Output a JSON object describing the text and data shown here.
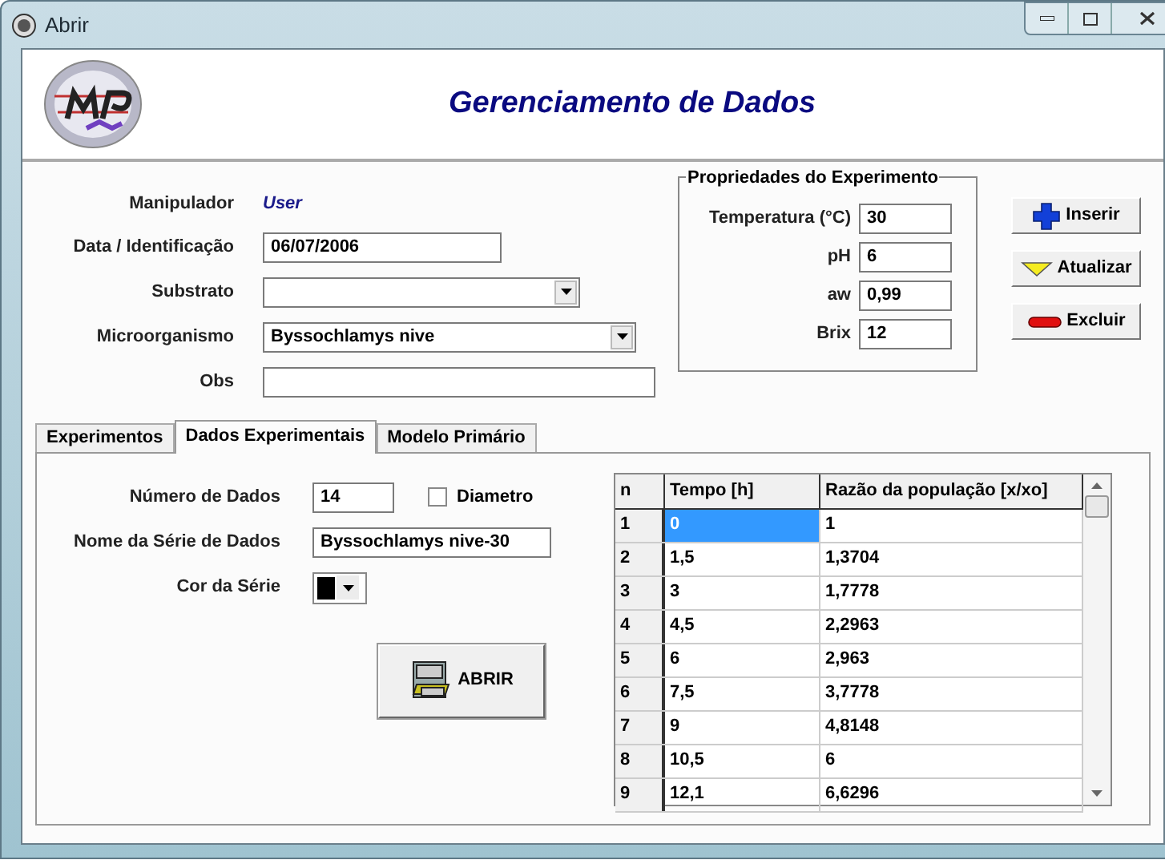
{
  "window": {
    "title": "Abrir"
  },
  "header": {
    "title": "Gerenciamento de Dados"
  },
  "form": {
    "manipulador": {
      "label": "Manipulador",
      "value": "User"
    },
    "data": {
      "label": "Data / Identificação",
      "value": "06/07/2006"
    },
    "substrato": {
      "label": "Substrato"
    },
    "microorganismo": {
      "label": "Microorganismo",
      "value": "Byssochlamys nive"
    },
    "obs": {
      "label": "Obs"
    }
  },
  "properties": {
    "title": "Propriedades do Experimento",
    "fields": [
      {
        "label": "Temperatura (°C)",
        "value": "30"
      },
      {
        "label": "pH",
        "value": "6"
      },
      {
        "label": "aw",
        "value": "0,99"
      },
      {
        "label": "Brix",
        "value": "12"
      }
    ]
  },
  "actions": [
    {
      "kind": "insert",
      "label": "Inserir"
    },
    {
      "kind": "update",
      "label": "Atualizar"
    },
    {
      "kind": "delete",
      "label": "Excluir"
    }
  ],
  "tabs": [
    {
      "label": "Experimentos",
      "selected": false
    },
    {
      "label": "Dados Experimentais",
      "selected": true
    },
    {
      "label": "Modelo Primário",
      "selected": false
    }
  ],
  "panel": {
    "count": {
      "label": "Número de Dados",
      "value": "14"
    },
    "diameter": {
      "label": "Diametro",
      "checked": false
    },
    "series_name": {
      "label": "Nome da Série de Dados",
      "value": "Byssochlamys nive-30"
    },
    "series_color": {
      "label": "Cor da Série",
      "color": "#000000"
    },
    "open_button": {
      "label": "ABRIR"
    }
  },
  "table": {
    "columns": [
      "n",
      "Tempo [h]",
      "Razão da população [x/xo]"
    ],
    "rows": [
      {
        "cells": [
          "1",
          "0",
          "1"
        ],
        "selected": true
      },
      {
        "cells": [
          "2",
          "1,5",
          "1,3704"
        ],
        "selected": false
      },
      {
        "cells": [
          "3",
          "3",
          "1,7778"
        ],
        "selected": false
      },
      {
        "cells": [
          "4",
          "4,5",
          "2,2963"
        ],
        "selected": false
      },
      {
        "cells": [
          "5",
          "6",
          "2,963"
        ],
        "selected": false
      },
      {
        "cells": [
          "6",
          "7,5",
          "3,7778"
        ],
        "selected": false
      },
      {
        "cells": [
          "7",
          "9",
          "4,8148"
        ],
        "selected": false
      },
      {
        "cells": [
          "8",
          "10,5",
          "6"
        ],
        "selected": false
      },
      {
        "cells": [
          "9",
          "12,1",
          "6,6296"
        ],
        "selected": false
      }
    ]
  }
}
